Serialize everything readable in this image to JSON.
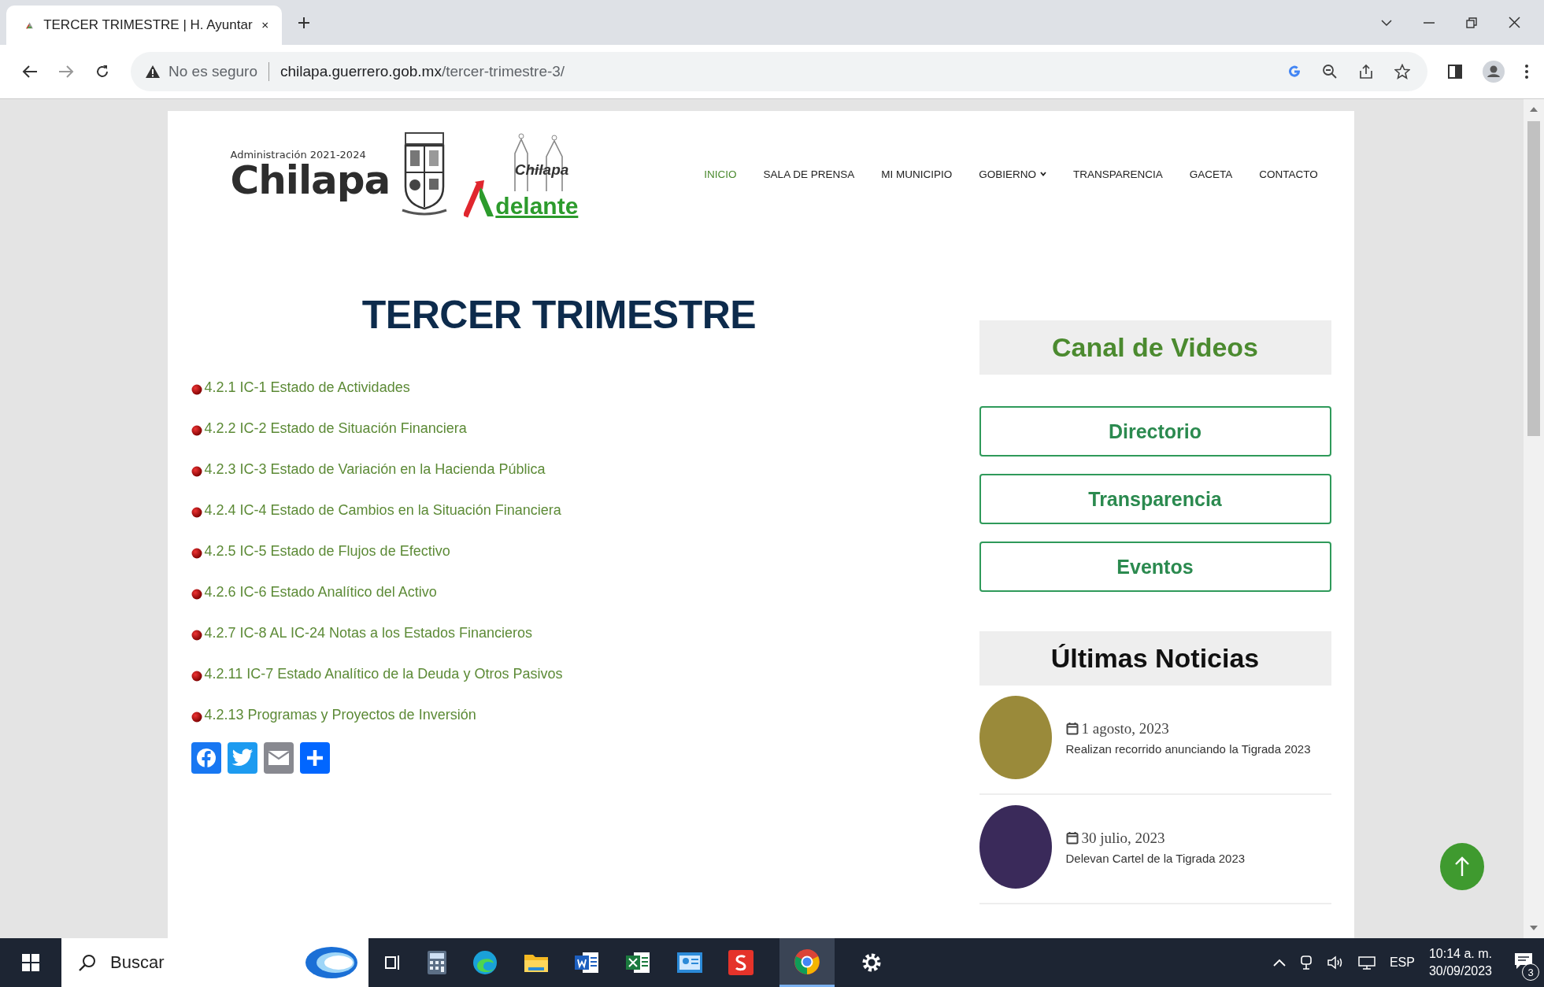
{
  "browser": {
    "tab_title": "TERCER TRIMESTRE | H. Ayuntar",
    "security": "No es seguro",
    "url_host": "chilapa.guerrero.gob.mx",
    "url_path": "/tercer-trimestre-3/"
  },
  "header": {
    "logo_caption": "Administración 2021-2024",
    "logo_name": "Chilapa",
    "slogan_top": "Chilapa",
    "slogan_bottom": "delante"
  },
  "nav": [
    {
      "label": "INICIO",
      "selected": true,
      "dropdown": false
    },
    {
      "label": "SALA DE PRENSA",
      "selected": false,
      "dropdown": false
    },
    {
      "label": "MI MUNICIPIO",
      "selected": false,
      "dropdown": false
    },
    {
      "label": "GOBIERNO",
      "selected": false,
      "dropdown": true
    },
    {
      "label": "TRANSPARENCIA",
      "selected": false,
      "dropdown": false
    },
    {
      "label": "GACETA",
      "selected": false,
      "dropdown": false
    },
    {
      "label": "CONTACTO",
      "selected": false,
      "dropdown": false
    }
  ],
  "title": "TERCER TRIMESTRE",
  "documents": [
    "4.2.1 IC-1 Estado de Actividades",
    "4.2.2 IC-2 Estado de Situación Financiera",
    "4.2.3 IC-3 Estado de Variación en la Hacienda Pública",
    "4.2.4 IC-4 Estado de Cambios en la Situación Financiera",
    "4.2.5 IC-5 Estado de Flujos de Efectivo",
    "4.2.6 IC-6 Estado Analítico del Activo",
    "4.2.7 IC-8 AL IC-24 Notas a los Estados Financieros",
    "4.2.11 IC-7 Estado Analítico de la Deuda y Otros Pasivos",
    "4.2.13 Programas y Proyectos de Inversión"
  ],
  "share": [
    {
      "kind": "facebook",
      "color": "#1877f2"
    },
    {
      "kind": "twitter",
      "color": "#1d9bf0"
    },
    {
      "kind": "email",
      "color": "#888990"
    },
    {
      "kind": "more",
      "color": "#0166ff"
    }
  ],
  "sidebar": {
    "videos_heading": "Canal de Videos",
    "buttons": [
      "Directorio",
      "Transparencia",
      "Eventos"
    ],
    "news_heading": "Últimas Noticias",
    "news": [
      {
        "date": "1 agosto, 2023",
        "title": "Realizan recorrido anunciando la Tigrada 2023"
      },
      {
        "date": "30 julio, 2023",
        "title": "Delevan Cartel de la Tigrada 2023"
      }
    ]
  },
  "taskbar": {
    "search_placeholder": "Buscar",
    "language": "ESP",
    "time": "10:14 a. m.",
    "date": "30/09/2023",
    "notifications": "3"
  }
}
